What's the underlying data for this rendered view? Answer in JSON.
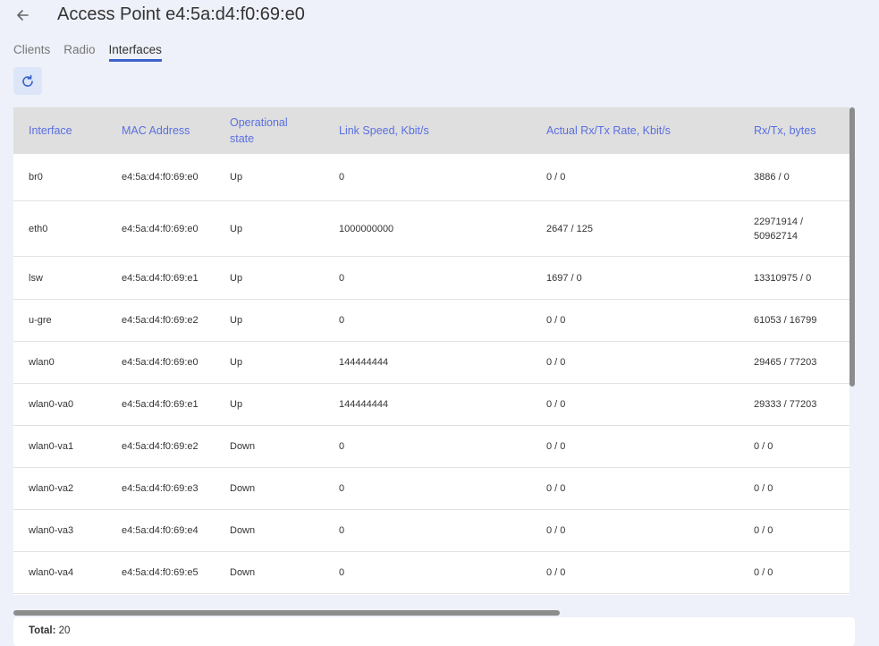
{
  "header": {
    "title": "Access Point e4:5a:d4:f0:69:e0",
    "back_icon": "arrow-left-icon"
  },
  "tabs": [
    {
      "label": "Clients",
      "active": false
    },
    {
      "label": "Radio",
      "active": false
    },
    {
      "label": "Interfaces",
      "active": true
    }
  ],
  "toolbar": {
    "refresh_icon": "refresh-icon"
  },
  "table": {
    "columns": [
      {
        "label": "Interface"
      },
      {
        "label": "MAC Address"
      },
      {
        "label": "Operational state"
      },
      {
        "label": "Link Speed, Kbit/s"
      },
      {
        "label": "Actual Rx/Tx Rate, Kbit/s"
      },
      {
        "label": "Rx/Tx, bytes"
      }
    ],
    "rows": [
      {
        "iface": "br0",
        "mac": "e4:5a:d4:f0:69:e0",
        "state": "Up",
        "speed": "0",
        "rate": "0 / 0",
        "bytes": "3886 / 0"
      },
      {
        "iface": "eth0",
        "mac": "e4:5a:d4:f0:69:e0",
        "state": "Up",
        "speed": "1000000000",
        "rate": "2647 / 125",
        "bytes": "22971914 / 50962714"
      },
      {
        "iface": "lsw",
        "mac": "e4:5a:d4:f0:69:e1",
        "state": "Up",
        "speed": "0",
        "rate": "1697 / 0",
        "bytes": "13310975 / 0"
      },
      {
        "iface": "u-gre",
        "mac": "e4:5a:d4:f0:69:e2",
        "state": "Up",
        "speed": "0",
        "rate": "0 / 0",
        "bytes": "61053 / 16799"
      },
      {
        "iface": "wlan0",
        "mac": "e4:5a:d4:f0:69:e0",
        "state": "Up",
        "speed": "144444444",
        "rate": "0 / 0",
        "bytes": "29465 / 77203"
      },
      {
        "iface": "wlan0-va0",
        "mac": "e4:5a:d4:f0:69:e1",
        "state": "Up",
        "speed": "144444444",
        "rate": "0 / 0",
        "bytes": "29333 / 77203"
      },
      {
        "iface": "wlan0-va1",
        "mac": "e4:5a:d4:f0:69:e2",
        "state": "Down",
        "speed": "0",
        "rate": "0 / 0",
        "bytes": "0 / 0"
      },
      {
        "iface": "wlan0-va2",
        "mac": "e4:5a:d4:f0:69:e3",
        "state": "Down",
        "speed": "0",
        "rate": "0 / 0",
        "bytes": "0 / 0"
      },
      {
        "iface": "wlan0-va3",
        "mac": "e4:5a:d4:f0:69:e4",
        "state": "Down",
        "speed": "0",
        "rate": "0 / 0",
        "bytes": "0 / 0"
      },
      {
        "iface": "wlan0-va4",
        "mac": "e4:5a:d4:f0:69:e5",
        "state": "Down",
        "speed": "0",
        "rate": "0 / 0",
        "bytes": "0 / 0"
      }
    ]
  },
  "footer": {
    "total_label": "Total:",
    "total_value": "20"
  },
  "colors": {
    "accent": "#3b63c8",
    "header_text": "#5a6fe0",
    "background": "#eef1f9"
  }
}
